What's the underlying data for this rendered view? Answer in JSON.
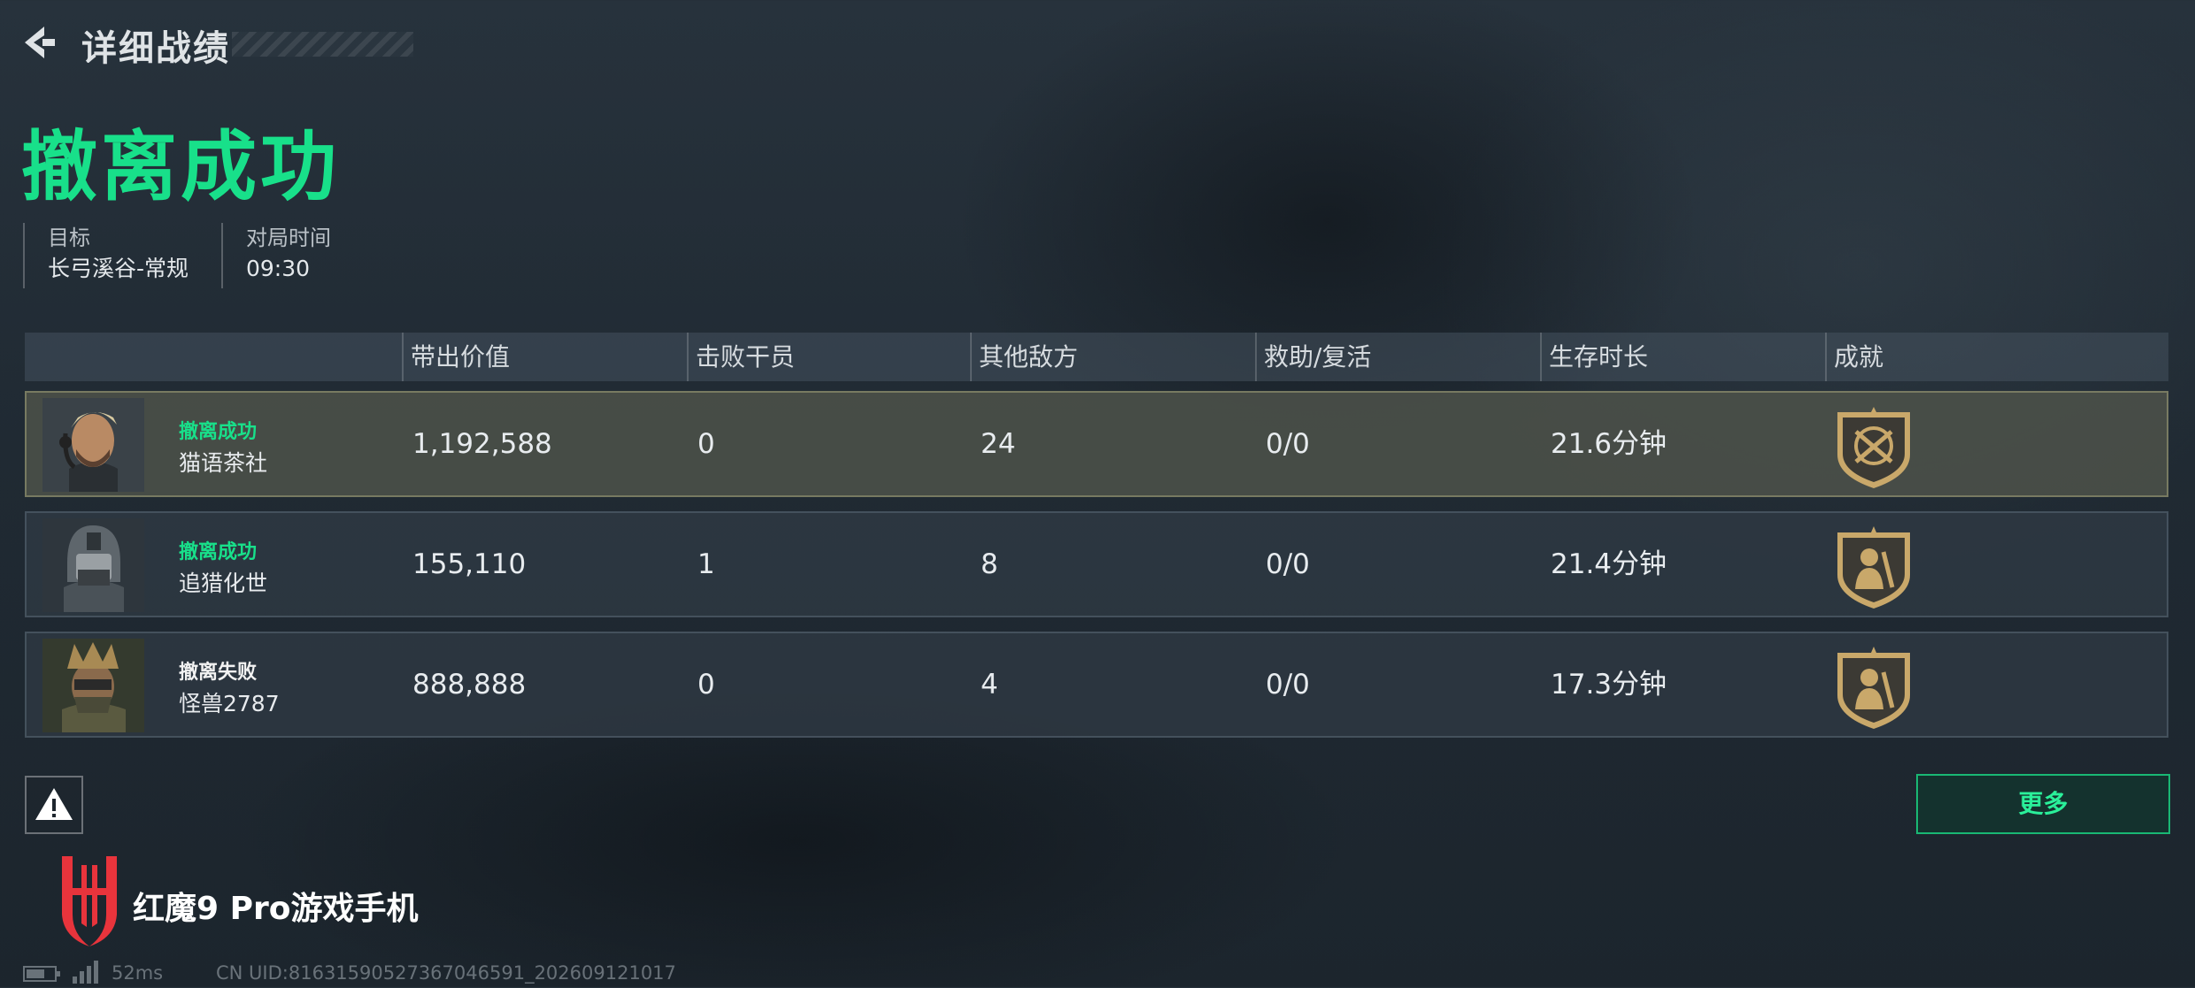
{
  "header": {
    "title": "详细战绩"
  },
  "result": {
    "title": "撤离成功"
  },
  "info": {
    "target_label": "目标",
    "target_value": "长弓溪谷-常规",
    "time_label": "对局时间",
    "time_value": "09:30"
  },
  "table": {
    "headers": [
      "带出价值",
      "击败干员",
      "其他敌方",
      "救助/复活",
      "生存时长",
      "成就"
    ],
    "rows": [
      {
        "status": "撤离成功",
        "status_color": "#18e08a",
        "name": "猫语茶社",
        "value": "1,192,588",
        "kills": "0",
        "others": "24",
        "assist": "0/0",
        "survival": "21.6分钟",
        "badge_icon": "crossed-target-shield-icon"
      },
      {
        "status": "撤离成功",
        "status_color": "#18e08a",
        "name": "追猎化世",
        "value": "155,110",
        "kills": "1",
        "others": "8",
        "assist": "0/0",
        "survival": "21.4分钟",
        "badge_icon": "soldier-shield-icon"
      },
      {
        "status": "撤离失败",
        "status_color": "#f2f2f2",
        "name": "怪兽2787",
        "value": "888,888",
        "kills": "0",
        "others": "4",
        "assist": "0/0",
        "survival": "17.3分钟",
        "badge_icon": "soldier-shield-icon"
      }
    ]
  },
  "buttons": {
    "more": "更多"
  },
  "brand": {
    "text": "红魔9 Pro游戏手机"
  },
  "footer": {
    "ping": "52ms",
    "uid": "CN UID:8163159052736704659​1_202609121017"
  },
  "colors": {
    "accent": "#18e08a",
    "gold": "#c9a86a"
  }
}
